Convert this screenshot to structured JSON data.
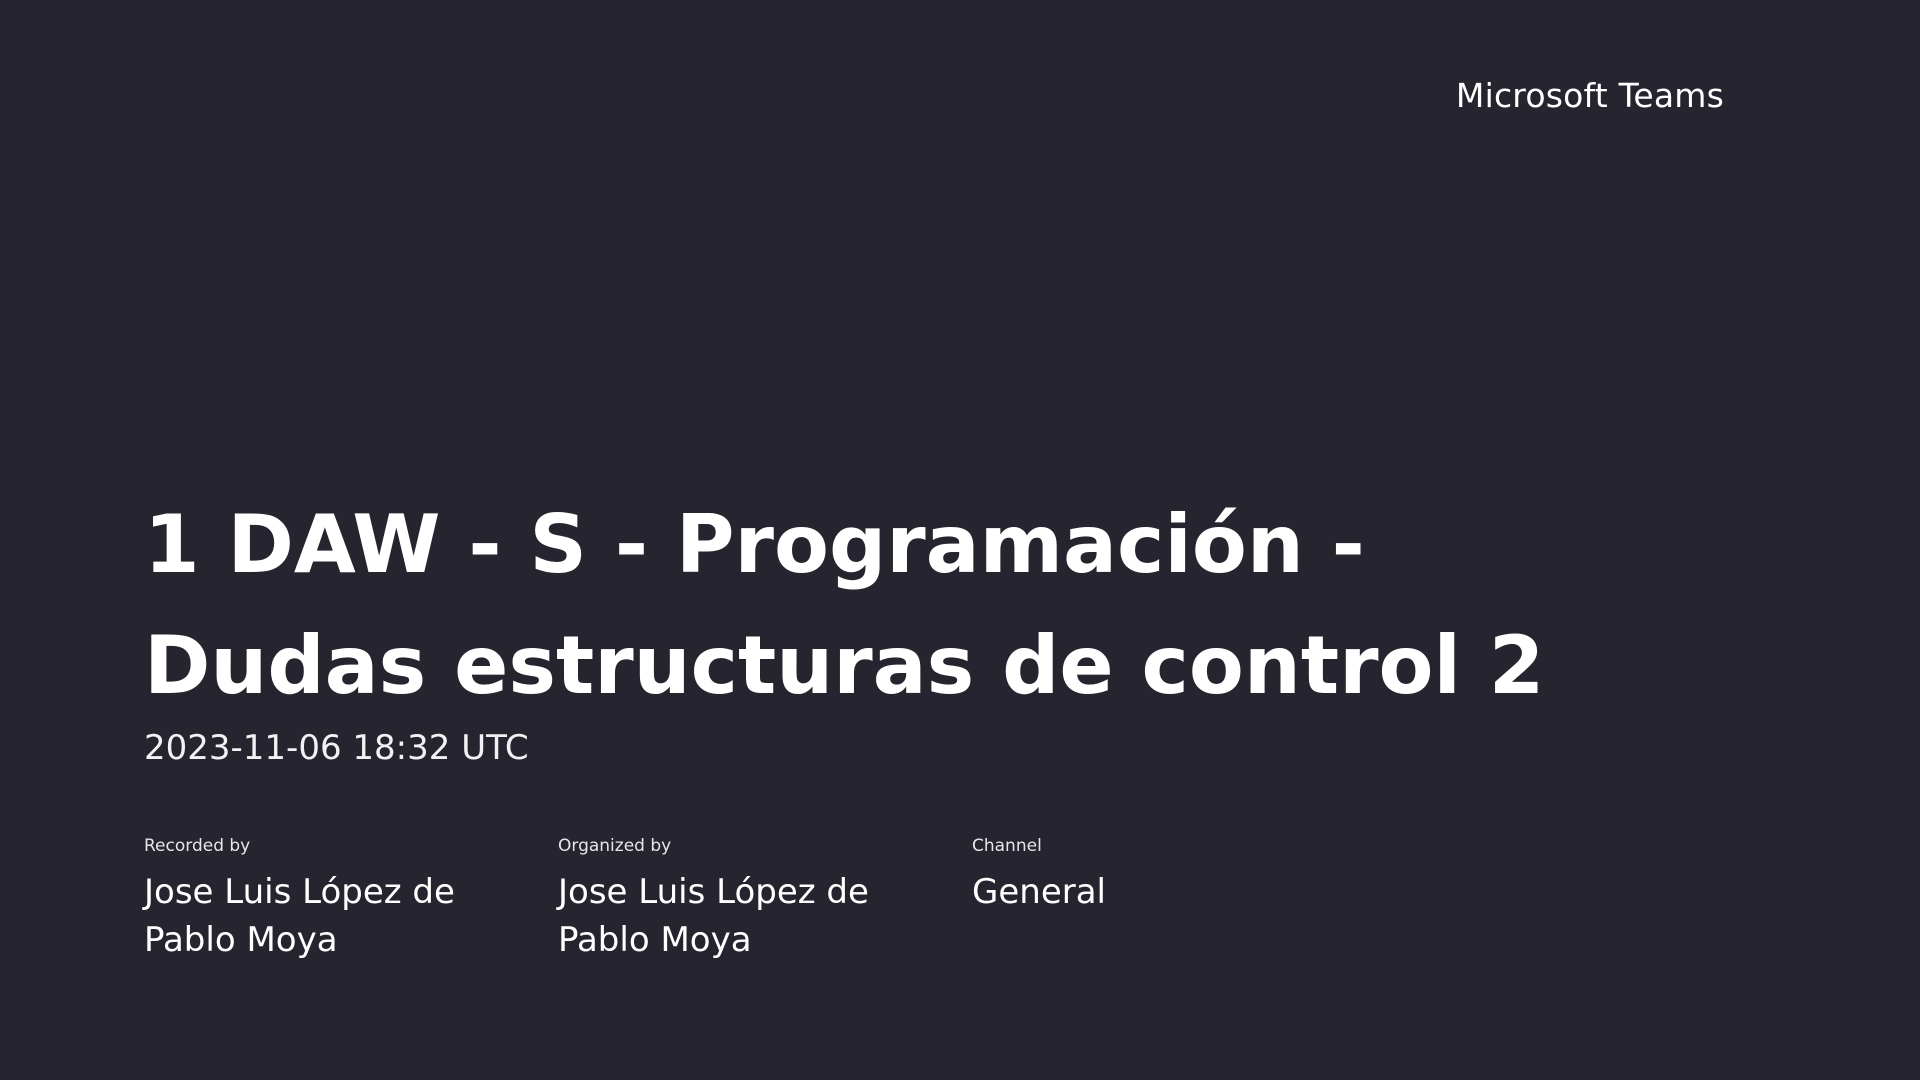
{
  "brand": "Microsoft Teams",
  "meeting": {
    "title": "1 DAW - S - Programación - Dudas estructuras de control 2",
    "datetime": "2023-11-06 18:32 UTC"
  },
  "details": {
    "recorded_by": {
      "label": "Recorded by",
      "value": "Jose Luis López de Pablo Moya"
    },
    "organized_by": {
      "label": "Organized by",
      "value": "Jose Luis López de Pablo Moya"
    },
    "channel": {
      "label": "Channel",
      "value": "General"
    }
  },
  "colors": {
    "background": "#26252f",
    "text": "#ffffff"
  }
}
